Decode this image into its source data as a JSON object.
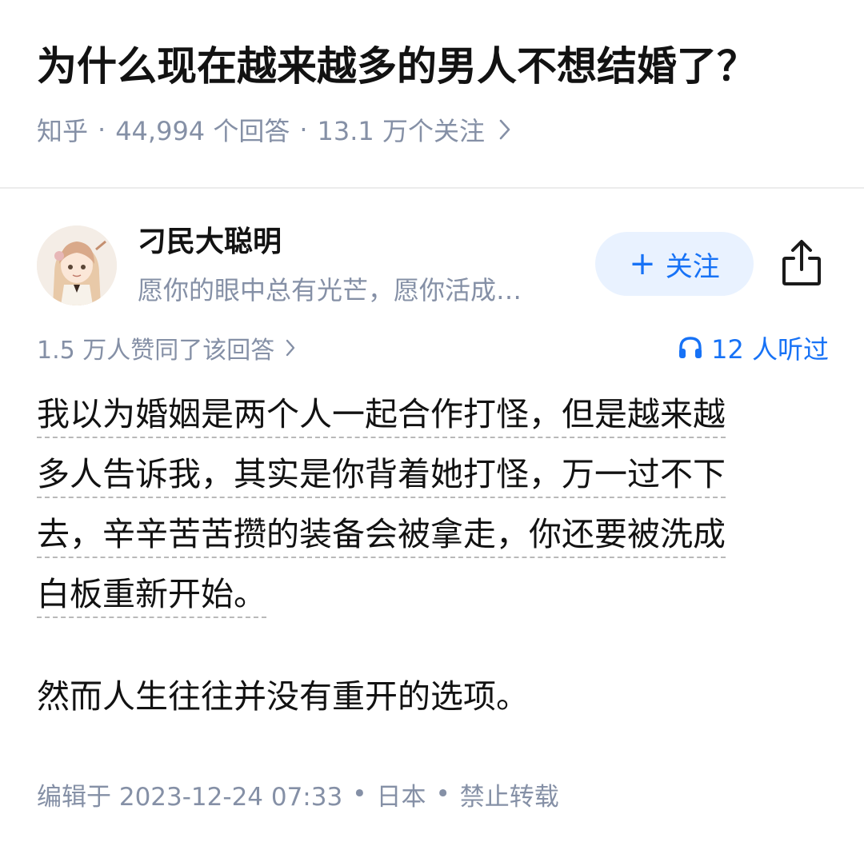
{
  "question": {
    "title": "为什么现在越来越多的男人不想结婚了？",
    "meta": {
      "source": "知乎",
      "answers": "44,994 个回答",
      "followers": "13.1 万个关注",
      "separator": "·"
    }
  },
  "author": {
    "name": "刁民大聪明",
    "bio": "愿你的眼中总有光芒，愿你活成…",
    "avatar_icon": "anime-girl-avatar",
    "follow_label": "关注",
    "follow_plus": "+",
    "share_icon": "share-icon"
  },
  "answer": {
    "votes": "1.5 万人赞同了该回答",
    "listeners": "12 人听过",
    "accent_color": "#1772f6",
    "paragraph1_lines": [
      "我以为婚姻是两个人一起合作打怪，但是越来越",
      "多人告诉我，其实是你背着她打怪，万一过不下",
      "去，辛辛苦苦攒的装备会被拿走，你还要被洗成",
      "白板重新开始。"
    ],
    "paragraph2": "然而人生往往并没有重开的选项。",
    "footer": {
      "edited": "编辑于 2023-12-24 07:33",
      "region": "日本",
      "copyright": "禁止转载",
      "separator": "•"
    }
  }
}
